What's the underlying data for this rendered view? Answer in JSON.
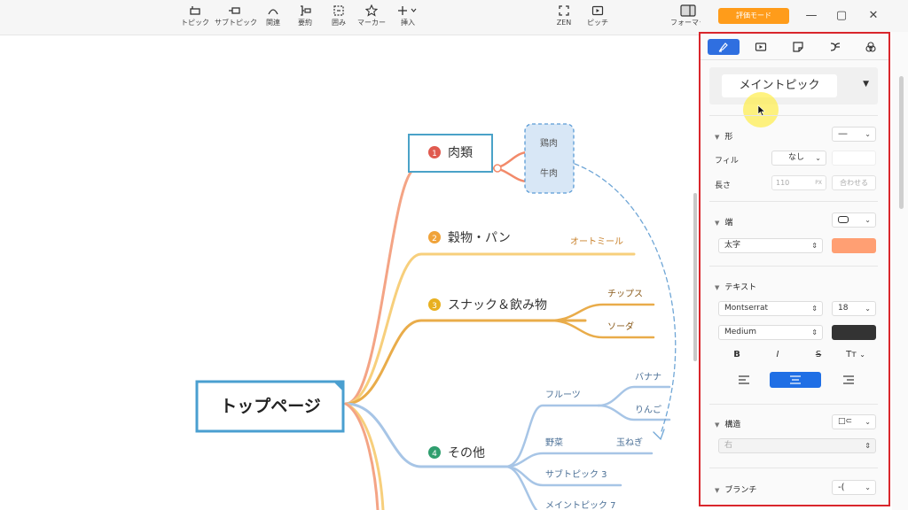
{
  "toolbar": {
    "items": [
      {
        "label": "トピック",
        "icon": "topic-icon"
      },
      {
        "label": "サブトピック",
        "icon": "subtopic-icon"
      },
      {
        "label": "関連",
        "icon": "relation-icon"
      },
      {
        "label": "要約",
        "icon": "summary-icon"
      },
      {
        "label": "囲み",
        "icon": "boundary-icon"
      },
      {
        "label": "マーカー",
        "icon": "star-icon"
      },
      {
        "label": "挿入",
        "icon": "plus-icon"
      }
    ],
    "zen_label": "ZEN",
    "pitch_label": "ピッチ",
    "format_label": "フォーマット"
  },
  "window": {
    "eval_badge": "評価モード",
    "minimize": "—",
    "maximize": "▢",
    "close": "✕"
  },
  "mindmap": {
    "root": "トップページ",
    "branches": [
      {
        "num": "1",
        "label": "肉類",
        "color": "#f28a6a",
        "children": [
          "鶏肉",
          "牛肉"
        ]
      },
      {
        "num": "2",
        "label": "穀物・パン",
        "color": "#f5c35f",
        "children": [
          "オートミール"
        ]
      },
      {
        "num": "3",
        "label": "スナック＆飲み物",
        "color": "#e8a23a",
        "children": [
          "チップス",
          "ソーダ"
        ]
      },
      {
        "num": "4",
        "label": "その他",
        "color": "#9dbfe3",
        "children": [
          "フルーツ",
          "野菜",
          "サブトピック 3",
          "メイントピック 7"
        ],
        "fruits": [
          "バナナ",
          "りんご"
        ],
        "veg": [
          "玉ねぎ"
        ]
      }
    ],
    "badge_colors": [
      "#e05a4f",
      "#f0a33a",
      "#e8b020",
      "#2f9e6e"
    ]
  },
  "panel": {
    "tabs": [
      "brush-icon",
      "slideshow-icon",
      "sticky-icon",
      "layout-icon",
      "theme-icon"
    ],
    "topic_type": "メイントピック",
    "shape": {
      "title": "形",
      "fill_label": "フィル",
      "fill_value": "なし",
      "length_label": "長さ",
      "length_value": "110",
      "length_unit": "PX",
      "fit_label": "合わせる"
    },
    "border": {
      "title": "端",
      "weight_value": "太字",
      "color": "#ff9f73"
    },
    "text": {
      "title": "テキスト",
      "font": "Montserrat",
      "size": "18",
      "weight": "Medium",
      "color": "#333333",
      "bold": "B",
      "italic": "I",
      "strike": "S",
      "case": "Tт"
    },
    "structure": {
      "title": "構造",
      "direction": "右"
    },
    "branch": {
      "title": "ブランチ"
    }
  }
}
